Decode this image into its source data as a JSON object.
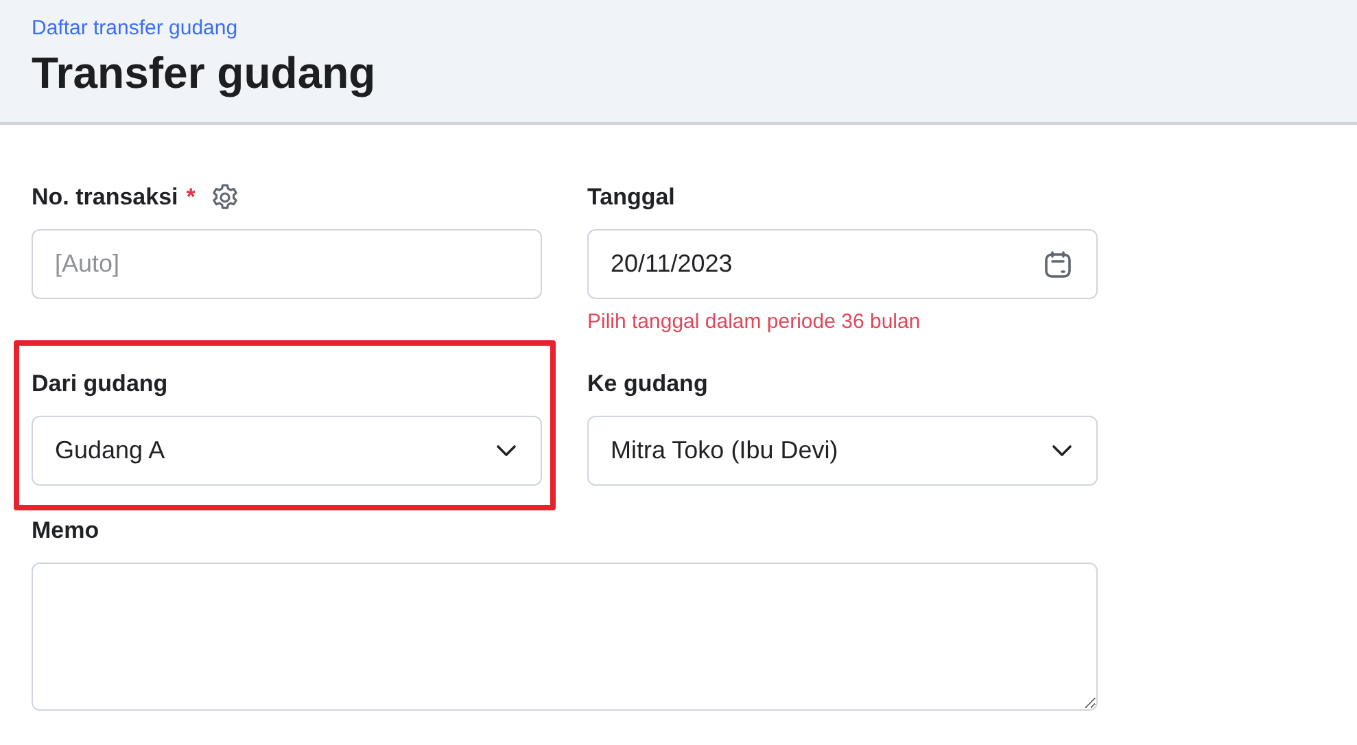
{
  "header": {
    "breadcrumb": "Daftar transfer gudang",
    "title": "Transfer gudang"
  },
  "fields": [
    {
      "kind": "text",
      "label": "No. transaksi",
      "required": true,
      "required_mark": "*",
      "settings": true,
      "placeholder": "[Auto]",
      "highlighted": false
    },
    {
      "kind": "date",
      "label": "Tanggal",
      "required": false,
      "settings": false,
      "value": "20/11/2023",
      "hint": "Pilih tanggal dalam periode 36 bulan",
      "highlighted": false
    },
    {
      "kind": "select",
      "label": "Dari gudang",
      "required": false,
      "settings": false,
      "value": "Gudang A",
      "highlighted": true
    },
    {
      "kind": "select",
      "label": "Ke gudang",
      "required": false,
      "settings": false,
      "value": "Mitra Toko (Ibu Devi)",
      "highlighted": false
    },
    {
      "kind": "textarea",
      "label": "Memo",
      "required": false,
      "settings": false,
      "highlighted": false
    }
  ]
}
